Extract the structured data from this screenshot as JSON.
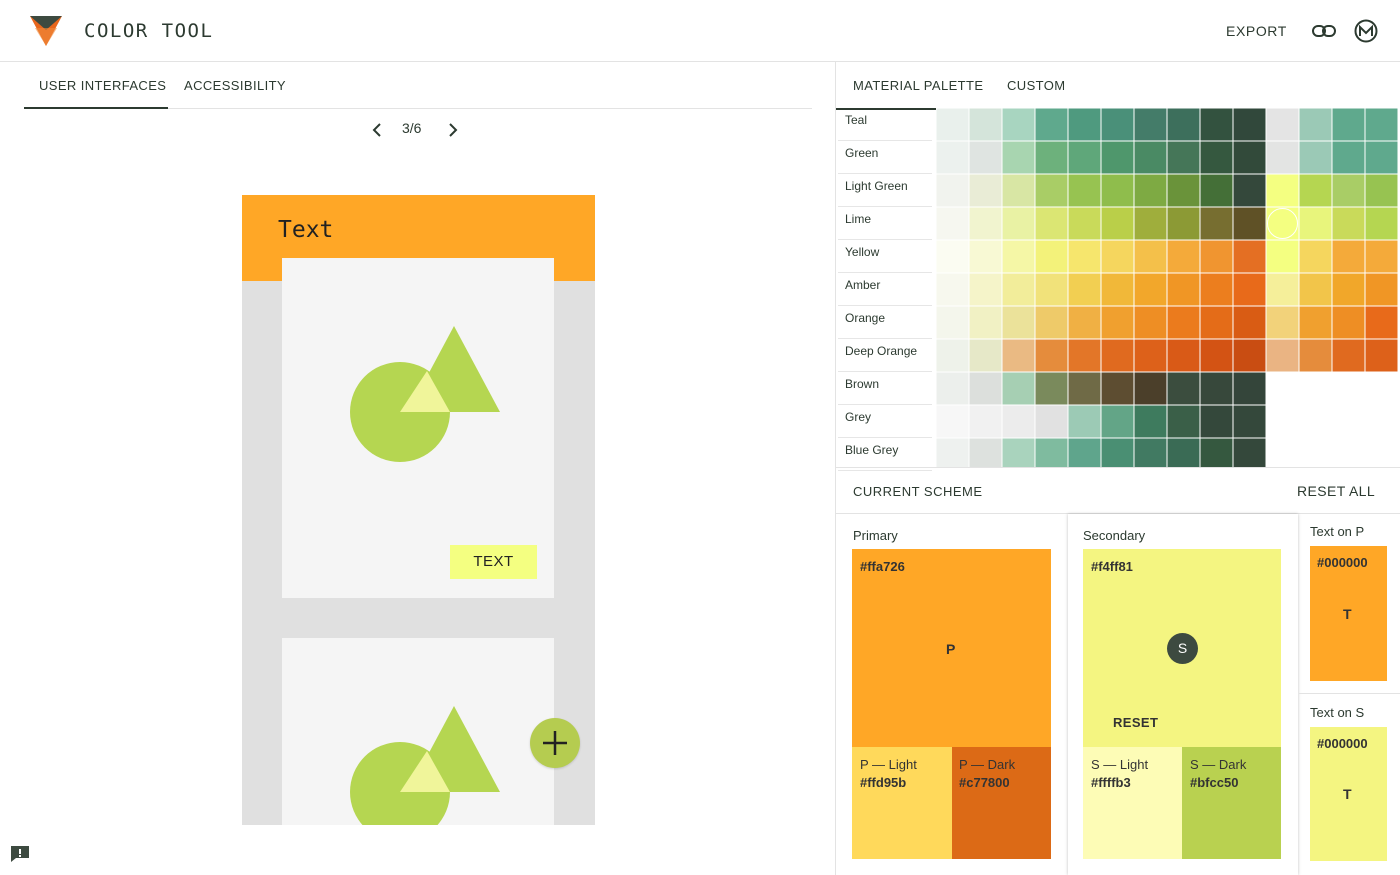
{
  "app": {
    "title": "COLOR TOOL"
  },
  "header": {
    "export_label": "EXPORT",
    "link_icon": "link-icon",
    "material_icon": "material-logo-icon"
  },
  "left": {
    "tabs": [
      {
        "label": "USER INTERFACES",
        "active": true
      },
      {
        "label": "ACCESSIBILITY",
        "active": false
      }
    ],
    "pager": {
      "text": "3/6"
    },
    "preview": {
      "appbar_title": "Text",
      "button_label": "TEXT",
      "fab_icon": "plus-icon",
      "primary_color": "#ffa726",
      "secondary_color": "#f4ff81",
      "accent_color": "#b5cc50"
    }
  },
  "right": {
    "tabs": [
      {
        "label": "MATERIAL PALETTE",
        "active": true
      },
      {
        "label": "CUSTOM",
        "active": false
      }
    ],
    "palette": {
      "rows": [
        "Teal",
        "Green",
        "Light Green",
        "Lime",
        "Yellow",
        "Amber",
        "Orange",
        "Deep Orange",
        "Brown",
        "Grey",
        "Blue Grey"
      ],
      "colors": [
        [
          "#e9f0ec",
          "#d4e4da",
          "#a8d5c0",
          "#5fa98d",
          "#4f9a7f",
          "#4a9079",
          "#447c69",
          "#3d6f5c",
          "#33523f",
          "#31483b",
          "#e4e4e4",
          "#9bc9b6",
          "#5fa98d",
          "#5fa98d"
        ],
        [
          "#ecf1ee",
          "#dfe4e1",
          "#a8d5b0",
          "#6db17c",
          "#5fa77a",
          "#4f976c",
          "#4a8a64",
          "#457658",
          "#35583f",
          "#324a3a",
          "#e3e4e3",
          "#9bc9b6",
          "#5fa98d",
          "#5fa98d"
        ],
        [
          "#f1f3ee",
          "#e9ecd6",
          "#d8e6a4",
          "#a9cd66",
          "#97c351",
          "#8fbd4c",
          "#7eaa43",
          "#6a933a",
          "#446f37",
          "#34483b",
          "#f4ff81",
          "#b5d651",
          "#a9cd66",
          "#97c351"
        ],
        [
          "#f6f7f0",
          "#f1f4cf",
          "#e9f2a4",
          "#dbe673",
          "#c9da5a",
          "#bacf49",
          "#9fae3c",
          "#8c9a35",
          "#776e30",
          "#5f5126",
          "#f4ff81",
          "#e8f57c",
          "#c9da5a",
          "#b5d651"
        ],
        [
          "#fbfcf2",
          "#f8f9d4",
          "#f5f7a6",
          "#f3f27a",
          "#f6e66d",
          "#f5d65e",
          "#f4c04a",
          "#f4aa3a",
          "#f09530",
          "#e46f23",
          "#f4ff81",
          "#f5d65e",
          "#f4aa3a",
          "#f4aa3a"
        ],
        [
          "#f7f8ee",
          "#f5f4c9",
          "#f2ed9a",
          "#f1e27a",
          "#f2cf52",
          "#f1b839",
          "#f2a72b",
          "#f09625",
          "#ec7e1e",
          "#e86a1a",
          "#f5ef9a",
          "#f2c54a",
          "#f1a72a",
          "#f09625"
        ],
        [
          "#f4f6ec",
          "#f1f1c4",
          "#ebe29a",
          "#eeca69",
          "#f0b044",
          "#f0a02f",
          "#ee8e24",
          "#eb7b1d",
          "#e46c18",
          "#d95c14",
          "#f2d27a",
          "#f0a02f",
          "#ee8e24",
          "#e86a1a"
        ],
        [
          "#eef2ea",
          "#e6e8c8",
          "#eaba83",
          "#e58c3c",
          "#e37628",
          "#e06a1f",
          "#dd611a",
          "#d95a17",
          "#d35314",
          "#c94d12",
          "#eab483",
          "#e58c3c",
          "#e06a1f",
          "#dd611a"
        ],
        [
          "#ecefec",
          "#dcdfdc",
          "#a6cfb3",
          "#7a8a5c",
          "#6f6a46",
          "#5d4d31",
          "#4b3f2a",
          "#3b4d3e",
          "#37483b",
          "#34453a",
          "",
          "",
          "",
          ""
        ],
        [
          "#f7f7f7",
          "#f1f1f1",
          "#ececec",
          "#e1e1e1",
          "#9ccab5",
          "#63a587",
          "#3e7b5e",
          "#3a5f48",
          "#34483b",
          "#34483b",
          "",
          "",
          "",
          ""
        ],
        [
          "#eef1ef",
          "#dde1de",
          "#a9d3bd",
          "#7fbb9f",
          "#5fa58c",
          "#4a8f73",
          "#417a62",
          "#3a6b55",
          "#35583f",
          "#34483b",
          "",
          "",
          "",
          ""
        ]
      ]
    },
    "scheme": {
      "title": "CURRENT SCHEME",
      "reset_all_label": "RESET ALL",
      "primary": {
        "label": "Primary",
        "hex": "#ffa726",
        "letter": "P",
        "light_label": "P — Light",
        "light_hex": "#ffd95b",
        "dark_label": "P — Dark",
        "dark_hex": "#c77800"
      },
      "secondary": {
        "label": "Secondary",
        "hex": "#f4ff81",
        "letter": "S",
        "reset_label": "RESET",
        "light_label": "S — Light",
        "light_hex": "#ffffb3",
        "dark_label": "S — Dark",
        "dark_hex": "#bfcc50"
      },
      "text_on_p": {
        "label": "Text on P",
        "hex": "#000000",
        "letter": "T"
      },
      "text_on_s": {
        "label": "Text on S",
        "hex": "#000000",
        "letter": "T"
      }
    }
  }
}
